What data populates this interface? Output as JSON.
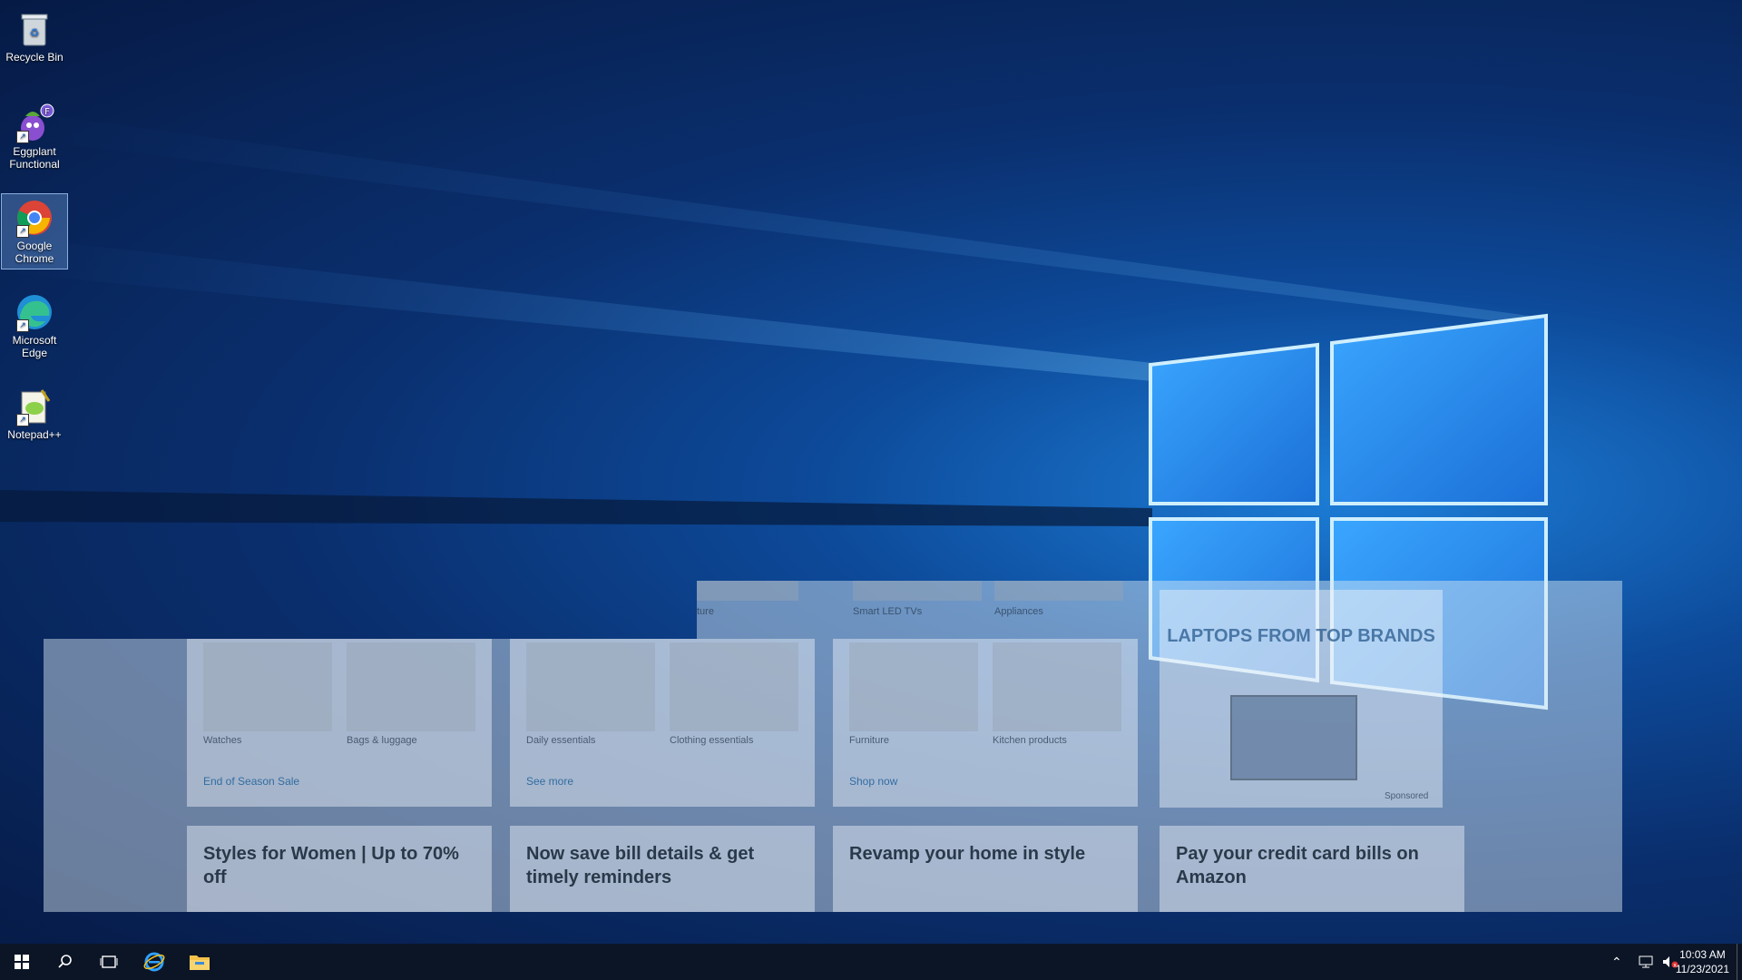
{
  "desktop": {
    "icons": [
      {
        "label": "Recycle Bin"
      },
      {
        "label": "Eggplant Functional"
      },
      {
        "label": "Google Chrome"
      },
      {
        "label": "Microsoft Edge"
      },
      {
        "label": "Notepad++"
      }
    ]
  },
  "overlay": {
    "top_captions": [
      "ture",
      "Smart LED TVs",
      "Appliances"
    ],
    "cards": [
      {
        "items": [
          "Watches",
          "Bags & luggage"
        ],
        "link": "End of Season Sale"
      },
      {
        "items": [
          "Daily essentials",
          "Clothing essentials"
        ],
        "link": "See more"
      },
      {
        "items": [
          "Furniture",
          "Kitchen products"
        ],
        "link": "Shop now"
      }
    ],
    "promo": {
      "title": "LAPTOPS FROM TOP BRANDS",
      "sponsored": "Sponsored"
    },
    "bottom_titles": [
      "Styles for Women | Up to 70% off",
      "Now save bill details & get timely reminders",
      "Revamp your home in style",
      "Pay your credit card bills on Amazon"
    ]
  },
  "taskbar": {
    "clock_time": "10:03 AM",
    "clock_date": "11/23/2021"
  },
  "colors": {
    "taskbar": "#0b1526",
    "accent": "#1d7fd8"
  }
}
